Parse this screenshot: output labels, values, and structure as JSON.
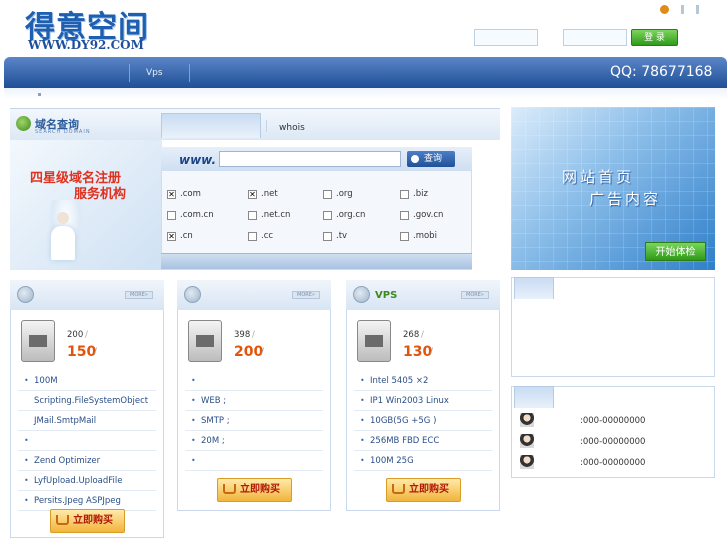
{
  "header": {
    "logo_cn": "得意空间",
    "logo_en": "WWW.DY92.COM",
    "login_label": "登 录"
  },
  "nav": {
    "vps_label": "Vps",
    "qq_text": "QQ:  78677168"
  },
  "domain_search": {
    "title": "域名查询",
    "subtitle": "SEARCH DOMAIN",
    "whois_tab": "whois",
    "www_label": "www.",
    "query_button": "查询",
    "tlds": [
      {
        "label": ".com",
        "checked": true
      },
      {
        "label": ".net",
        "checked": true
      },
      {
        "label": ".org",
        "checked": false
      },
      {
        "label": ".biz",
        "checked": false
      },
      {
        "label": ".com.cn",
        "checked": false
      },
      {
        "label": ".net.cn",
        "checked": false
      },
      {
        "label": ".org.cn",
        "checked": false
      },
      {
        "label": ".gov.cn",
        "checked": false
      },
      {
        "label": ".cn",
        "checked": true
      },
      {
        "label": ".cc",
        "checked": false
      },
      {
        "label": ".tv",
        "checked": false
      },
      {
        "label": ".mobi",
        "checked": false
      }
    ]
  },
  "banner": {
    "line1": "四星级域名注册",
    "line2": "服务机构"
  },
  "ad": {
    "line1": "网站首页",
    "line2": "广告内容",
    "button": "开始体检"
  },
  "plans": [
    {
      "title": "",
      "more": "MORE»",
      "price_small": "200",
      "price_big": "150",
      "features": [
        "100M",
        "Scripting.FileSystemObject",
        "JMail.SmtpMail",
        "",
        "Zend Optimizer",
        "LyfUpload.UploadFile",
        "Persits.Jpeg ASPJpeg"
      ],
      "buy_label": "立即购买"
    },
    {
      "title": "",
      "more": "MORE»",
      "price_small": "398",
      "price_big": "200",
      "features": [
        "",
        "WEB       ;",
        "SMTP                 ;",
        "20M ;",
        ""
      ],
      "buy_label": "立即购买"
    },
    {
      "title": "VPS",
      "more": "MORE»",
      "price_small": "268",
      "price_big": "130",
      "features": [
        "Intel 5405      ×2",
        "IP1 Win2003 Linux",
        "10GB(5G +5G )",
        "256MB FBD ECC",
        "100M  25G"
      ],
      "buy_label": "立即购买"
    }
  ],
  "contacts": {
    "phones": [
      ":000-00000000",
      ":000-00000000",
      ":000-00000000"
    ]
  },
  "colors": {
    "brand_blue": "#1f5fb0",
    "price_orange": "#e2540b",
    "nav_blue": "#204f96",
    "green_button": "#2f9b1a"
  }
}
